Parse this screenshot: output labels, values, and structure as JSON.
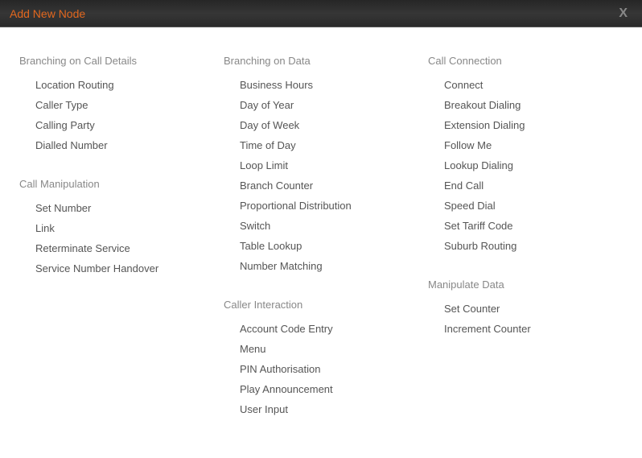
{
  "dialog": {
    "title": "Add New Node",
    "close_symbol": "X"
  },
  "columns": [
    [
      {
        "title": "Branching on Call Details",
        "items": [
          "Location Routing",
          "Caller Type",
          "Calling Party",
          "Dialled Number"
        ]
      },
      {
        "title": "Call Manipulation",
        "items": [
          "Set Number",
          "Link",
          "Reterminate Service",
          "Service Number Handover"
        ]
      }
    ],
    [
      {
        "title": "Branching on Data",
        "items": [
          "Business Hours",
          "Day of Year",
          "Day of Week",
          "Time of Day",
          "Loop Limit",
          "Branch Counter",
          "Proportional Distribution",
          "Switch",
          "Table Lookup",
          "Number Matching"
        ]
      },
      {
        "title": "Caller Interaction",
        "items": [
          "Account Code Entry",
          "Menu",
          "PIN Authorisation",
          "Play Announcement",
          "User Input"
        ]
      }
    ],
    [
      {
        "title": "Call Connection",
        "items": [
          "Connect",
          "Breakout Dialing",
          "Extension Dialing",
          "Follow Me",
          "Lookup Dialing",
          "End Call",
          "Speed Dial",
          "Set Tariff Code",
          "Suburb Routing"
        ]
      },
      {
        "title": "Manipulate Data",
        "items": [
          "Set Counter",
          "Increment Counter"
        ]
      }
    ]
  ]
}
